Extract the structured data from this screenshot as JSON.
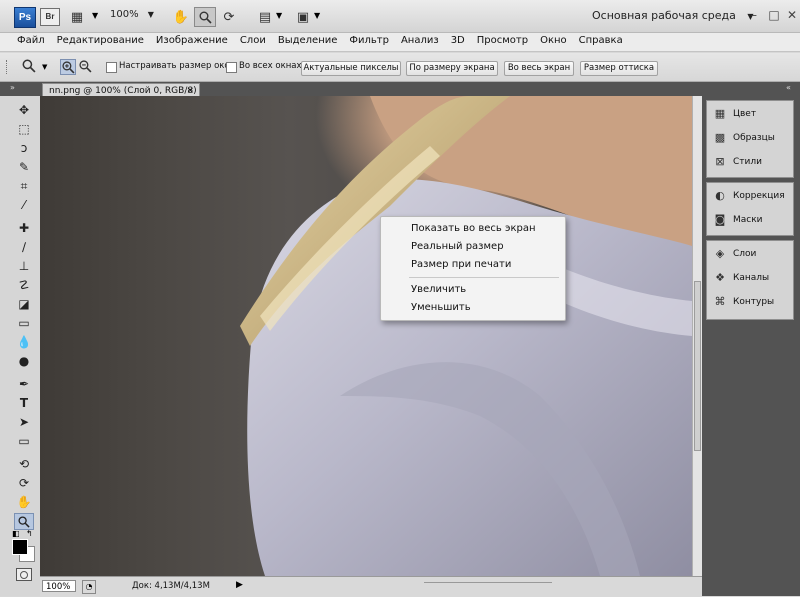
{
  "appbar": {
    "ps_logo": "Ps",
    "br_logo": "Br",
    "zoom": "100%",
    "workspace": "Основная рабочая среда",
    "workspace_arrow": "▼"
  },
  "menu": [
    "Файл",
    "Редактирование",
    "Изображение",
    "Слои",
    "Выделение",
    "Фильтр",
    "Анализ",
    "3D",
    "Просмотр",
    "Окно",
    "Справка"
  ],
  "options": {
    "resize_windows": "Настраивать размер окон",
    "all_windows": "Во всех окнах",
    "actual_pixels": "Актуальные пикселы",
    "fit_screen": "По размеру экрана",
    "fill_screen": "Во весь экран",
    "print_size": "Размер оттиска"
  },
  "document": {
    "tab_title": "nn.png @ 100% (Слой 0, RGB/8)",
    "tab_close": "×",
    "status_zoom": "100%",
    "status_doc": "Док: 4,13M/4,13M",
    "status_arrow": "▶"
  },
  "panels": {
    "group1": [
      "Цвет",
      "Образцы",
      "Стили"
    ],
    "group2": [
      "Коррекция",
      "Маски"
    ],
    "group3": [
      "Слои",
      "Каналы",
      "Контуры"
    ]
  },
  "context_menu": {
    "items": [
      "Показать во весь экран",
      "Реальный размер",
      "Размер при печати",
      "Увеличить",
      "Уменьшить"
    ]
  },
  "colors": {
    "foreground": "#000000",
    "background": "#ffffff",
    "accent": "#1a4f9c"
  }
}
